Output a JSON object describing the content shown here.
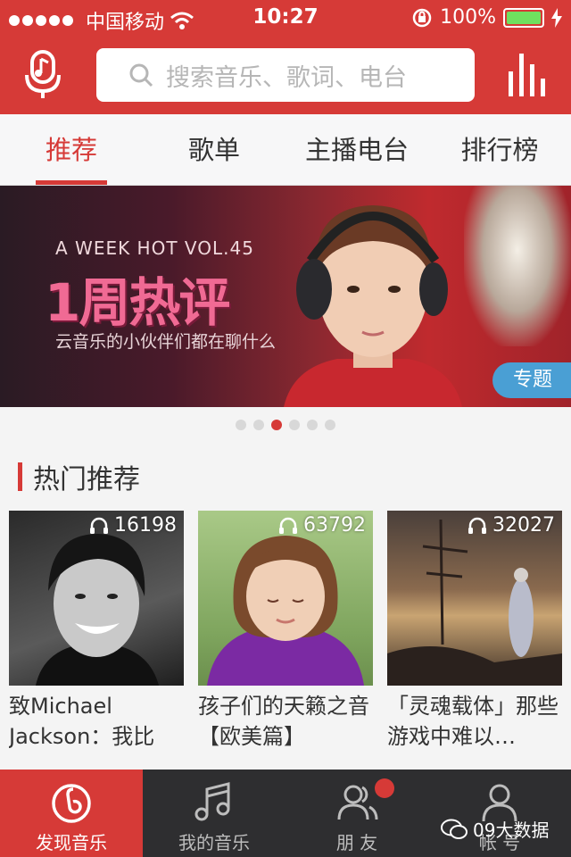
{
  "status": {
    "carrier": "中国移动",
    "time": "10:27",
    "battery": "100%",
    "battery_level": 1.0,
    "icons": [
      "signal-dots-icon",
      "wifi-icon",
      "rotation-lock-icon",
      "battery-icon",
      "charging-icon"
    ]
  },
  "header": {
    "search_placeholder": "搜索音乐、歌词、电台",
    "mic_icon": "mic-icon",
    "search_icon": "search-icon",
    "eq_icon": "equalizer-icon"
  },
  "tabs": [
    {
      "label": "推荐",
      "active": true
    },
    {
      "label": "歌单",
      "active": false
    },
    {
      "label": "主播电台",
      "active": false
    },
    {
      "label": "排行榜",
      "active": false
    }
  ],
  "banner": {
    "kicker": "A WEEK HOT  VOL.45",
    "title": "1周热评",
    "subtitle": "云音乐的小伙伴们都在聊什么",
    "tag": "专题",
    "pages": 6,
    "current_page": 3
  },
  "section": {
    "title": "热门推荐"
  },
  "cards": [
    {
      "count": "16198",
      "title": "致Michael Jackson：我比曾…",
      "icon": "headphones-icon"
    },
    {
      "count": "63792",
      "title": "孩子们的天籁之音【欧美篇】",
      "icon": "headphones-icon"
    },
    {
      "count": "32027",
      "title": "「灵魂载体」那些游戏中难以…",
      "icon": "headphones-icon"
    }
  ],
  "tabbar": [
    {
      "label": "发现音乐",
      "icon": "netease-music-icon",
      "active": true
    },
    {
      "label": "我的音乐",
      "icon": "music-note-icon",
      "active": false
    },
    {
      "label": "朋 友",
      "icon": "friends-icon",
      "active": false
    },
    {
      "label": "帐 号",
      "icon": "account-icon",
      "active": false
    }
  ],
  "watermark": "09大数据",
  "colors": {
    "accent": "#d63a37",
    "tabbar": "#2e2e30",
    "tag": "#4a9fd4"
  }
}
